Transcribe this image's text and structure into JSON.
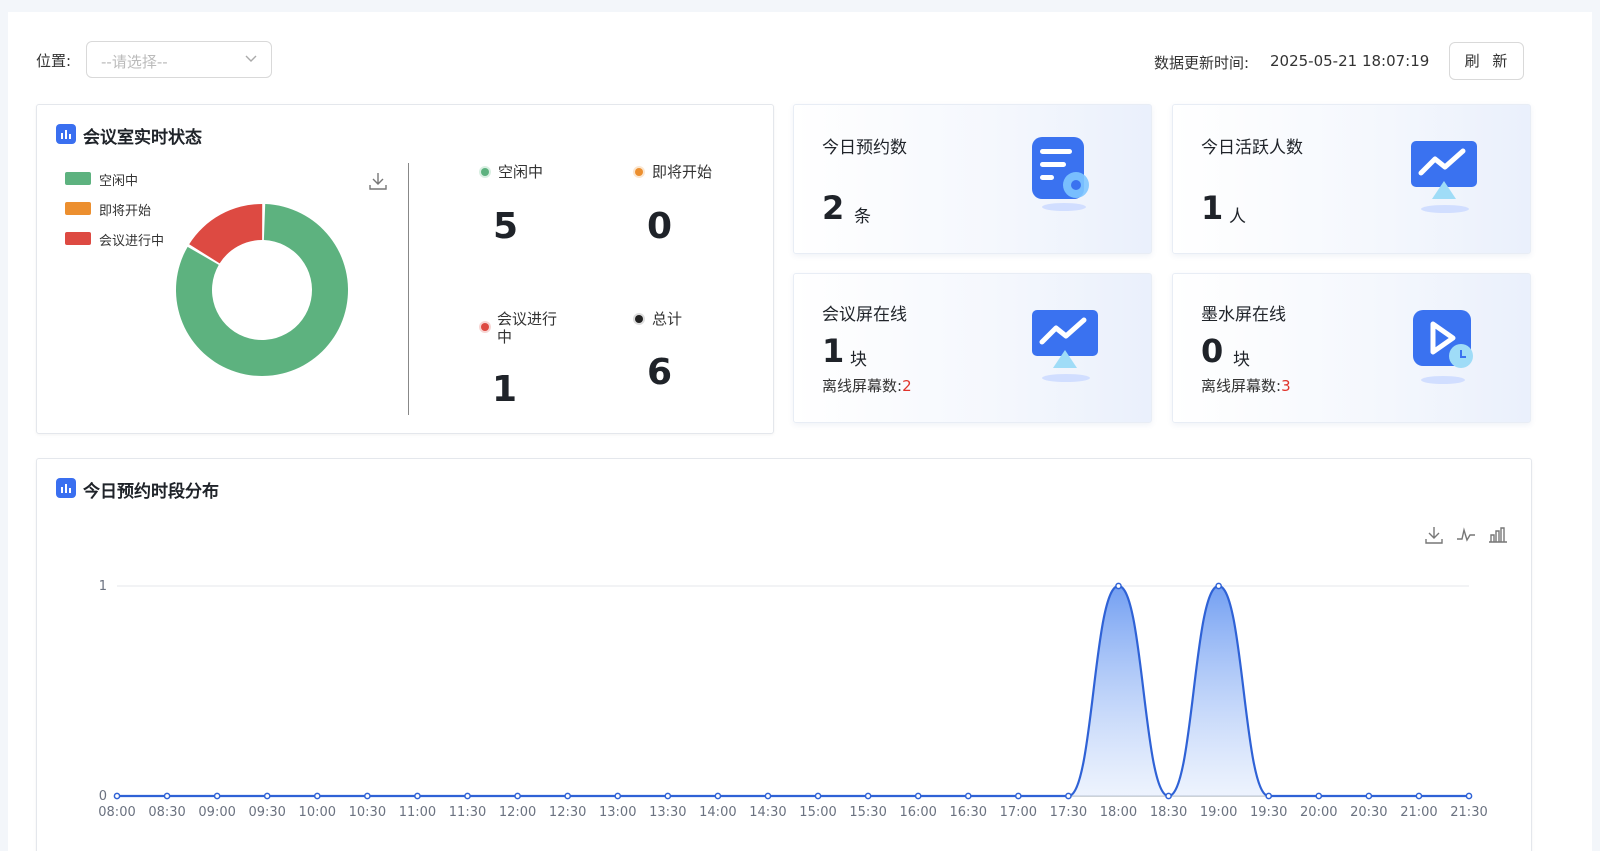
{
  "filter": {
    "location_label": "位置:",
    "location_placeholder": "--请选择--"
  },
  "header": {
    "update_label": "数据更新时间:",
    "update_time": "2025-05-21 18:07:19",
    "refresh_label": "刷 新"
  },
  "room_status": {
    "title": "会议室实时状态",
    "legend": [
      {
        "label": "空闲中",
        "color": "#5db27f"
      },
      {
        "label": "即将开始",
        "color": "#ec8f2f"
      },
      {
        "label": "会议进行中",
        "color": "#dd4a42"
      }
    ],
    "stats": [
      {
        "label": "空闲中",
        "value": "5",
        "dot_color": "#5db27f"
      },
      {
        "label": "即将开始",
        "value": "0",
        "dot_color": "#ec8f2f"
      },
      {
        "label": "会议进行中",
        "value": "1",
        "dot_color": "#dd4a42"
      },
      {
        "label": "总计",
        "value": "6",
        "dot_color": "#222222"
      }
    ]
  },
  "kpis": {
    "bookings": {
      "title": "今日预约数",
      "value": "2",
      "unit": "条",
      "icon": "document-gear-icon"
    },
    "active_users": {
      "title": "今日活跃人数",
      "value": "1",
      "unit": "人",
      "icon": "trend-monitor-icon"
    },
    "meeting_screens": {
      "title": "会议屏在线",
      "value": "1",
      "unit": "块",
      "offline_label": "离线屏幕数:",
      "offline_value": "2",
      "icon": "trend-monitor-icon"
    },
    "ink_screens": {
      "title": "墨水屏在线",
      "value": "0",
      "unit": "块",
      "offline_label": "离线屏幕数:",
      "offline_value": "3",
      "icon": "play-clock-icon"
    }
  },
  "booking_chart": {
    "title": "今日预约时段分布",
    "tools": [
      "download-icon",
      "line-chart-icon",
      "bar-chart-icon"
    ]
  },
  "chart_data": [
    {
      "type": "pie",
      "donut": true,
      "categories": [
        "空闲中",
        "即将开始",
        "会议进行中"
      ],
      "values": [
        5,
        0,
        1
      ],
      "colors": [
        "#5db27f",
        "#ec8f2f",
        "#dd4a42"
      ],
      "legend": "top-left"
    },
    {
      "type": "area",
      "smooth": true,
      "x": [
        "08:00",
        "08:30",
        "09:00",
        "09:30",
        "10:00",
        "10:30",
        "11:00",
        "11:30",
        "12:00",
        "12:30",
        "13:00",
        "13:30",
        "14:00",
        "14:30",
        "15:00",
        "15:30",
        "16:00",
        "16:30",
        "17:00",
        "17:30",
        "18:00",
        "18:30",
        "19:00",
        "19:30",
        "20:00",
        "20:30",
        "21:00",
        "21:30"
      ],
      "values": [
        0,
        0,
        0,
        0,
        0,
        0,
        0,
        0,
        0,
        0,
        0,
        0,
        0,
        0,
        0,
        0,
        0,
        0,
        0,
        0,
        1,
        0,
        1,
        0,
        0,
        0,
        0,
        0
      ],
      "ylim": [
        0,
        1
      ],
      "yticks": [
        0,
        1
      ],
      "grid": true,
      "color": "#2f62d6"
    }
  ]
}
